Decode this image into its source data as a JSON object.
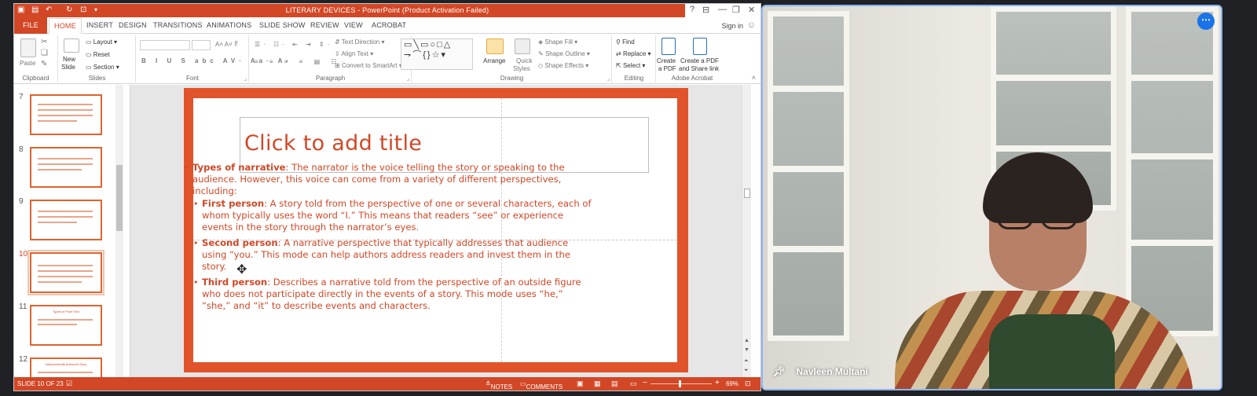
{
  "ppt": {
    "title": "LITERARY DEVICES - PowerPoint (Product Activation Failed)",
    "help": "?",
    "signin": "Sign in",
    "tabs": [
      "FILE",
      "HOME",
      "INSERT",
      "DESIGN",
      "TRANSITIONS",
      "ANIMATIONS",
      "SLIDE SHOW",
      "REVIEW",
      "VIEW",
      "ACROBAT"
    ],
    "active_tab": "HOME",
    "ribbon": {
      "clipboard": {
        "label": "Clipboard",
        "paste": "Paste"
      },
      "slides": {
        "label": "Slides",
        "new_slide_line1": "New",
        "new_slide_line2": "Slide",
        "layout": "Layout",
        "reset": "Reset",
        "section": "Section"
      },
      "font": {
        "label": "Font"
      },
      "paragraph": {
        "label": "Paragraph",
        "text_direction": "Text Direction",
        "align_text": "Align Text",
        "convert_smartart": "Convert to SmartArt"
      },
      "drawing": {
        "label": "Drawing",
        "arrange": "Arrange",
        "quick_styles_1": "Quick",
        "quick_styles_2": "Styles",
        "shape_fill": "Shape Fill",
        "shape_outline": "Shape Outline",
        "shape_effects": "Shape Effects"
      },
      "editing": {
        "label": "Editing",
        "find": "Find",
        "replace": "Replace",
        "select": "Select"
      },
      "acrobat": {
        "label": "Adobe Acrobat",
        "create_pdf_1": "Create",
        "create_pdf_2": "a PDF",
        "create_share_1": "Create a PDF",
        "create_share_2": "and Share link"
      }
    },
    "thumbnails": [
      {
        "num": "7",
        "selected": false
      },
      {
        "num": "8",
        "selected": false
      },
      {
        "num": "9",
        "selected": false
      },
      {
        "num": "10",
        "selected": true
      },
      {
        "num": "11",
        "selected": false,
        "title": "Types of Point Text"
      },
      {
        "num": "12",
        "selected": false,
        "title": "Independently Authored Story"
      }
    ],
    "slide": {
      "title_placeholder": "Click to add title",
      "b1_bold": "Types of narrative",
      "b1_text": ": The narrator is the voice telling the story or speaking to the audience. However, this voice can come from a variety of different perspectives, including:",
      "b2_bold": "First person",
      "b2_text": ": A story told from the perspective of one or several characters, each of whom typically uses the word “I.” This means that readers “see” or experience events in the story through the narrator’s eyes.",
      "b3_bold": "Second person",
      "b3_text": ": A narrative perspective that typically addresses that audience using “you.” This mode can help authors address readers and invest them in the story.",
      "b4_bold": "Third person",
      "b4_text": ": Describes a narrative told from the perspective of an outside figure who does not participate directly in the events of a story. This mode uses “he,” “she,” and “it” to describe events and characters."
    },
    "status": {
      "slide_info": "SLIDE 10 OF 23",
      "notes": "NOTES",
      "comments": "COMMENTS",
      "zoom": "69%"
    },
    "colors": {
      "accent": "#d24726",
      "slide_border": "#e0532b"
    }
  },
  "video": {
    "participant_name": "Navleen Multani",
    "border_color": "#8ab4f8",
    "more_button": "more-options-icon"
  }
}
